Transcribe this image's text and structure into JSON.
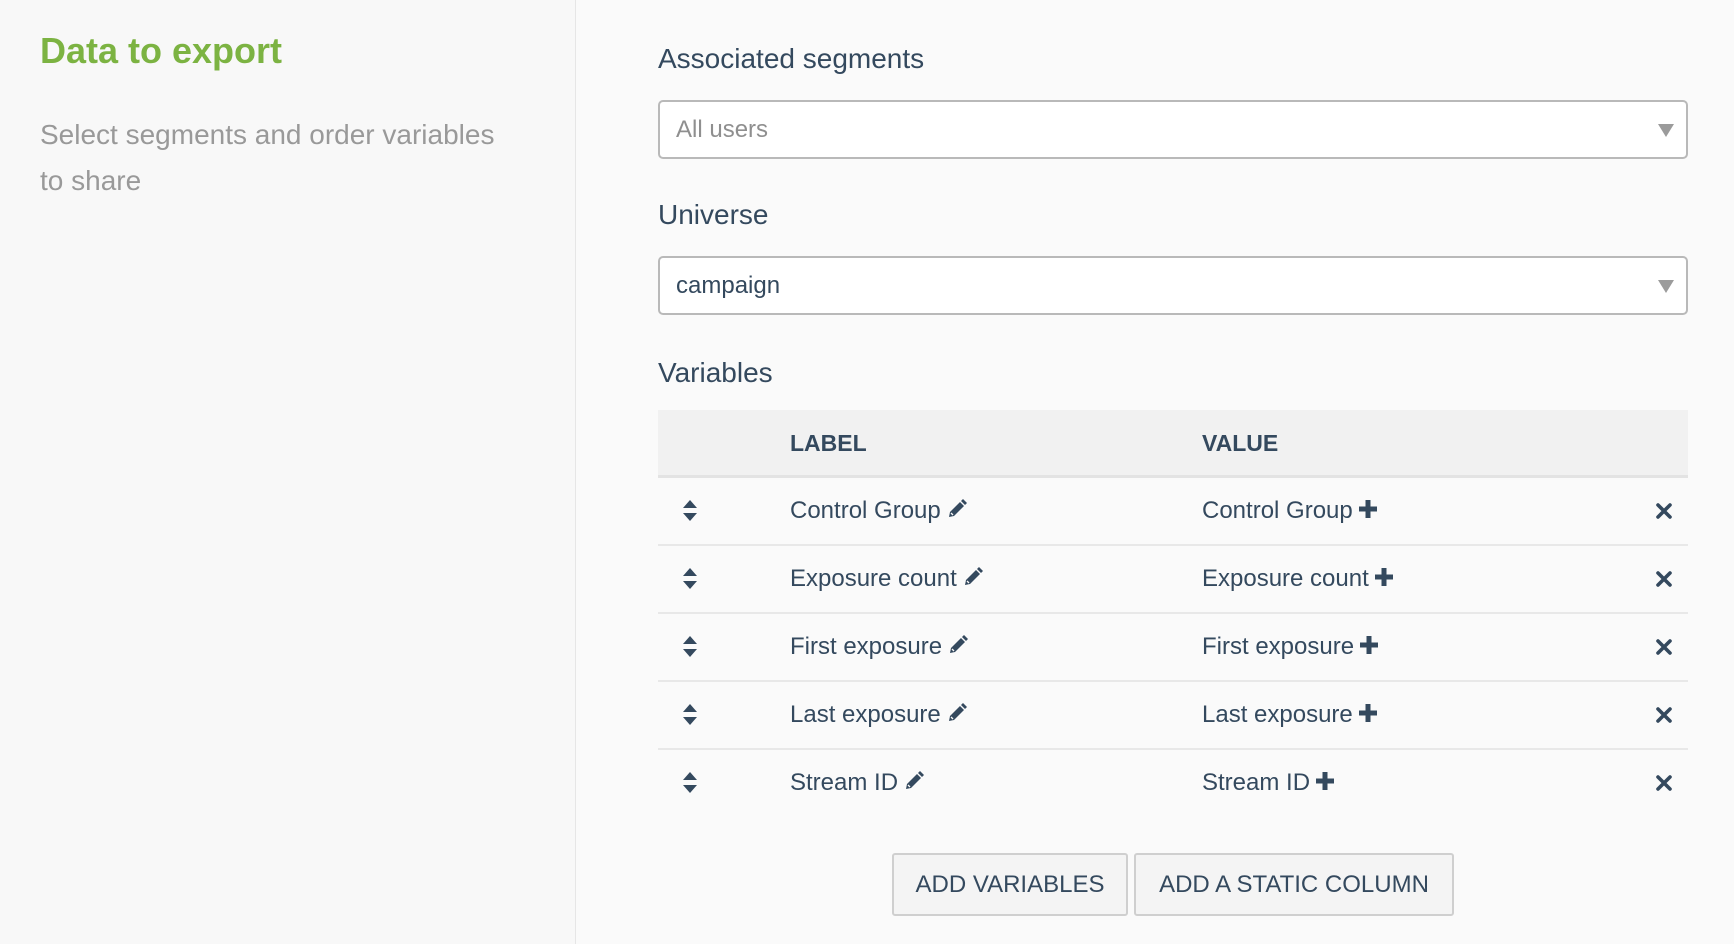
{
  "sidebar": {
    "title": "Data to export",
    "description": "Select segments and order variables to share"
  },
  "segments": {
    "label": "Associated segments",
    "placeholder": "All users"
  },
  "universe": {
    "label": "Universe",
    "value": "campaign"
  },
  "variables": {
    "title": "Variables",
    "columns": {
      "label": "LABEL",
      "value": "VALUE"
    },
    "rows": [
      {
        "label": "Control Group",
        "value": "Control Group"
      },
      {
        "label": "Exposure count",
        "value": "Exposure count"
      },
      {
        "label": "First exposure",
        "value": "First exposure"
      },
      {
        "label": "Last exposure",
        "value": "Last exposure"
      },
      {
        "label": "Stream ID",
        "value": "Stream ID"
      }
    ]
  },
  "actions": {
    "add_variables": "ADD VARIABLES",
    "add_static_column": "ADD A STATIC COLUMN"
  },
  "icons": {
    "sort": "sort-icon",
    "edit": "pencil-icon",
    "add": "plus-icon",
    "remove": "close-icon",
    "dropdown": "caret-down-icon"
  },
  "colors": {
    "accent": "#7cb342",
    "text": "#34495e",
    "muted": "#999999"
  }
}
